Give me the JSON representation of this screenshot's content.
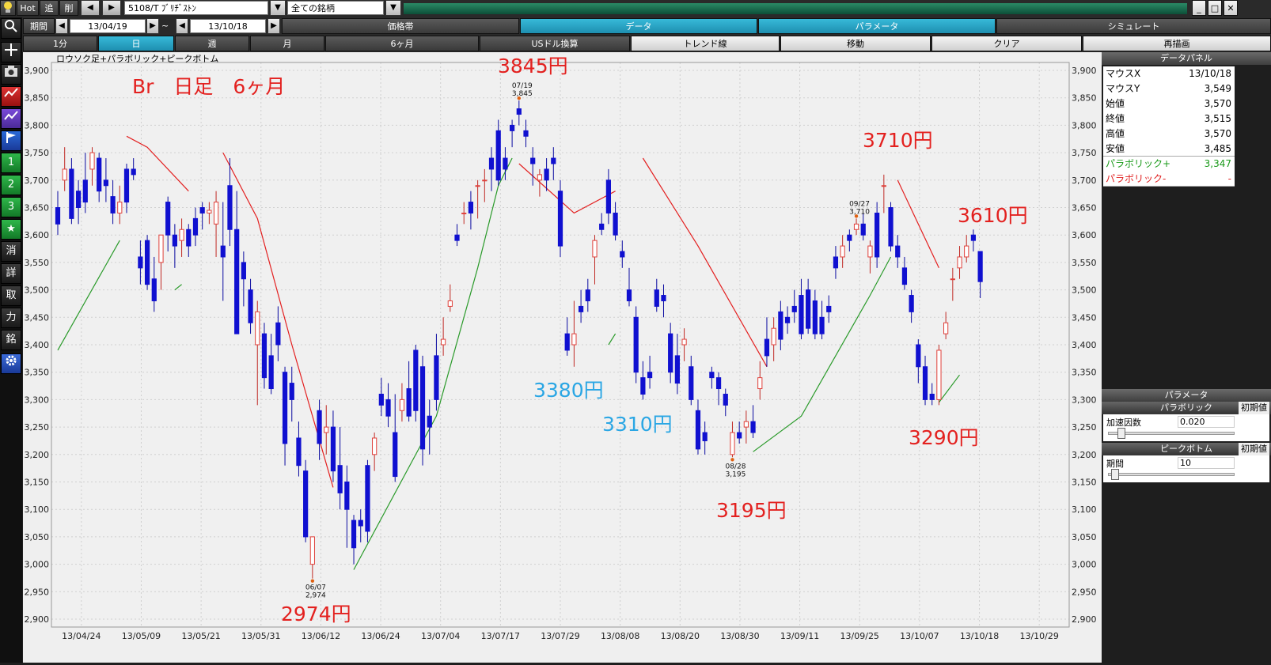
{
  "toolbar": {
    "hot": "Hot",
    "tsui": "追",
    "sakujo": "削",
    "symbol": "5108/T ﾌﾞﾘﾁﾞｽﾄﾝ",
    "list": "全ての銘柄",
    "period_label": "期間",
    "date_from": "13/04/19",
    "tilde": "~",
    "date_to": "13/10/18",
    "tabs": [
      "価格帯",
      "データ",
      "パラメータ",
      "シミュレート"
    ],
    "intervals": [
      "1分",
      "日",
      "週",
      "月",
      "6ヶ月"
    ],
    "tools": [
      "USドル換算",
      "トレンド線",
      "移動",
      "クリア",
      "再描画"
    ]
  },
  "sidebar_labels": [
    "1",
    "2",
    "3",
    "★",
    "消",
    "詳",
    "取",
    "力",
    "銘"
  ],
  "icons": [
    "bulb-icon",
    "prev-arrow-icon",
    "next-arrow-icon",
    "dropdown-icon",
    "search-icon",
    "crosshair-icon",
    "camera-icon",
    "candle-chart-icon",
    "line-chart-icon",
    "flag-icon",
    "star-icon",
    "gear-icon"
  ],
  "chart_title": "ロウソク足+パラボリック+ピークボトム",
  "annotations": {
    "title": "Br　日足　6ヶ月",
    "a3845": "3845円",
    "a2974": "2974円",
    "a3380": "3380円",
    "a3310": "3310円",
    "a3195": "3195円",
    "a3710": "3710円",
    "a3610": "3610円",
    "a3290": "3290円"
  },
  "data_panel": {
    "header": "データパネル",
    "rows": [
      {
        "k": "マウスX",
        "v": "13/10/18"
      },
      {
        "k": "マウスY",
        "v": "3,549"
      },
      {
        "k": "始値",
        "v": "3,570"
      },
      {
        "k": "終値",
        "v": "3,515"
      },
      {
        "k": "高値",
        "v": "3,570"
      },
      {
        "k": "安値",
        "v": "3,485"
      },
      {
        "k": "パラボリック+",
        "v": "3,347"
      },
      {
        "k": "パラボリック-",
        "v": "-"
      }
    ]
  },
  "param_panel": {
    "header": "パラメータ",
    "parabolic": "パラボリック",
    "reset1": "初期値",
    "accel_label": "加速因数",
    "accel": "0.020",
    "peak": "ピークボトム",
    "reset2": "初期値",
    "period_label": "期間",
    "period": "10"
  },
  "colors": {
    "up": "#e0403a",
    "down": "#1010d0",
    "sar_plus": "#2a9a2a",
    "sar_minus": "#e32020",
    "cyan": "#1e9fc4"
  },
  "chart_data": {
    "type": "candlestick",
    "title": "ロウソク足+パラボリック+ピークボトム",
    "ylim": [
      2900,
      3900
    ],
    "yticks": [
      "3,900",
      "3,850",
      "3,800",
      "3,750",
      "3,700",
      "3,650",
      "3,600",
      "3,550",
      "3,500",
      "3,450",
      "3,400",
      "3,350",
      "3,300",
      "3,250",
      "3,200",
      "3,150",
      "3,100",
      "3,050",
      "3,000",
      "2,950",
      "2,900"
    ],
    "xticks": [
      "13/04/24",
      "13/05/09",
      "13/05/21",
      "13/05/31",
      "13/06/12",
      "13/06/24",
      "13/07/04",
      "13/07/17",
      "13/07/29",
      "13/08/08",
      "13/08/20",
      "13/08/30",
      "13/09/11",
      "13/09/25",
      "13/10/07",
      "13/10/18",
      "13/10/29"
    ],
    "peaks": [
      {
        "date": "06/07",
        "value": "2,974"
      },
      {
        "date": "07/19",
        "value": "3,845"
      },
      {
        "date": "08/28",
        "value": "3,195"
      },
      {
        "date": "09/27",
        "value": "3,710"
      }
    ],
    "candles": [
      [
        3650,
        3680,
        3600,
        3620
      ],
      [
        3700,
        3760,
        3680,
        3720
      ],
      [
        3720,
        3740,
        3620,
        3630
      ],
      [
        3680,
        3700,
        3620,
        3650
      ],
      [
        3700,
        3750,
        3640,
        3660
      ],
      [
        3720,
        3760,
        3690,
        3750
      ],
      [
        3740,
        3750,
        3660,
        3680
      ],
      [
        3700,
        3740,
        3660,
        3690
      ],
      [
        3670,
        3700,
        3620,
        3640
      ],
      [
        3640,
        3690,
        3620,
        3660
      ],
      [
        3720,
        3730,
        3640,
        3660
      ],
      [
        3720,
        3740,
        3700,
        3710
      ],
      [
        3560,
        3590,
        3510,
        3540
      ],
      [
        3590,
        3600,
        3500,
        3510
      ],
      [
        3520,
        3560,
        3460,
        3480
      ],
      [
        3550,
        3600,
        3500,
        3600
      ],
      [
        3660,
        3670,
        3570,
        3600
      ],
      [
        3600,
        3620,
        3540,
        3580
      ],
      [
        3590,
        3630,
        3560,
        3610
      ],
      [
        3610,
        3620,
        3560,
        3580
      ],
      [
        3630,
        3650,
        3580,
        3600
      ],
      [
        3650,
        3660,
        3610,
        3640
      ],
      [
        3640,
        3660,
        3620,
        3645
      ],
      [
        3620,
        3680,
        3560,
        3660
      ],
      [
        3580,
        3660,
        3480,
        3560
      ],
      [
        3690,
        3740,
        3580,
        3610
      ],
      [
        3610,
        3680,
        3450,
        3420
      ],
      [
        3550,
        3570,
        3470,
        3520
      ],
      [
        3500,
        3520,
        3420,
        3440
      ],
      [
        3400,
        3480,
        3290,
        3460
      ],
      [
        3420,
        3440,
        3320,
        3340
      ],
      [
        3380,
        3420,
        3310,
        3320
      ],
      [
        3440,
        3470,
        3370,
        3400
      ],
      [
        3350,
        3360,
        3180,
        3220
      ],
      [
        3330,
        3360,
        3260,
        3300
      ],
      [
        3230,
        3260,
        3160,
        3180
      ],
      [
        3170,
        3190,
        3040,
        3050
      ],
      [
        3000,
        3050,
        2974,
        3050
      ],
      [
        3280,
        3300,
        3190,
        3220
      ],
      [
        3240,
        3290,
        3200,
        3250
      ],
      [
        3250,
        3280,
        3150,
        3170
      ],
      [
        3180,
        3250,
        3100,
        3130
      ],
      [
        3150,
        3180,
        3030,
        3100
      ],
      [
        3080,
        3090,
        3000,
        3030
      ],
      [
        3080,
        3100,
        3040,
        3070
      ],
      [
        3180,
        3190,
        3040,
        3060
      ],
      [
        3200,
        3240,
        3170,
        3230
      ],
      [
        3310,
        3340,
        3270,
        3290
      ],
      [
        3300,
        3330,
        3250,
        3270
      ],
      [
        3240,
        3310,
        3150,
        3160
      ],
      [
        3280,
        3330,
        3260,
        3300
      ],
      [
        3320,
        3370,
        3260,
        3270
      ],
      [
        3390,
        3400,
        3260,
        3280
      ],
      [
        3360,
        3380,
        3180,
        3210
      ],
      [
        3270,
        3300,
        3200,
        3250
      ],
      [
        3380,
        3420,
        3280,
        3300
      ],
      [
        3400,
        3450,
        3380,
        3410
      ],
      [
        3470,
        3510,
        3460,
        3480
      ],
      [
        3600,
        3620,
        3580,
        3590
      ],
      [
        3640,
        3660,
        3620,
        3640
      ],
      [
        3660,
        3680,
        3610,
        3640
      ],
      [
        3690,
        3700,
        3630,
        3690
      ],
      [
        3700,
        3720,
        3660,
        3700
      ],
      [
        3740,
        3760,
        3680,
        3720
      ],
      [
        3790,
        3810,
        3690,
        3700
      ],
      [
        3740,
        3760,
        3700,
        3720
      ],
      [
        3800,
        3810,
        3760,
        3790
      ],
      [
        3830,
        3845,
        3800,
        3820
      ],
      [
        3790,
        3810,
        3760,
        3780
      ],
      [
        3740,
        3760,
        3690,
        3730
      ],
      [
        3700,
        3720,
        3670,
        3710
      ],
      [
        3720,
        3740,
        3680,
        3700
      ],
      [
        3740,
        3760,
        3700,
        3730
      ],
      [
        3680,
        3700,
        3560,
        3580
      ],
      [
        3420,
        3450,
        3380,
        3390
      ],
      [
        3400,
        3480,
        3360,
        3420
      ],
      [
        3470,
        3500,
        3440,
        3460
      ],
      [
        3500,
        3520,
        3460,
        3480
      ],
      [
        3560,
        3600,
        3510,
        3590
      ],
      [
        3620,
        3640,
        3600,
        3610
      ],
      [
        3700,
        3720,
        3620,
        3640
      ],
      [
        3640,
        3660,
        3590,
        3600
      ],
      [
        3570,
        3590,
        3540,
        3560
      ],
      [
        3500,
        3540,
        3470,
        3480
      ],
      [
        3450,
        3470,
        3330,
        3350
      ],
      [
        3340,
        3370,
        3300,
        3310
      ],
      [
        3350,
        3380,
        3320,
        3340
      ],
      [
        3500,
        3520,
        3460,
        3470
      ],
      [
        3490,
        3510,
        3450,
        3480
      ],
      [
        3420,
        3440,
        3330,
        3350
      ],
      [
        3380,
        3420,
        3310,
        3330
      ],
      [
        3400,
        3430,
        3370,
        3410
      ],
      [
        3360,
        3380,
        3290,
        3300
      ],
      [
        3280,
        3300,
        3200,
        3210
      ],
      [
        3240,
        3260,
        3200,
        3225
      ],
      [
        3350,
        3360,
        3320,
        3340
      ],
      [
        3340,
        3350,
        3290,
        3320
      ],
      [
        3310,
        3320,
        3270,
        3290
      ],
      [
        3200,
        3260,
        3195,
        3240
      ],
      [
        3240,
        3260,
        3220,
        3230
      ],
      [
        3250,
        3280,
        3220,
        3260
      ],
      [
        3260,
        3290,
        3230,
        3240
      ],
      [
        3320,
        3370,
        3300,
        3340
      ],
      [
        3410,
        3450,
        3360,
        3380
      ],
      [
        3400,
        3450,
        3370,
        3430
      ],
      [
        3460,
        3480,
        3390,
        3410
      ],
      [
        3450,
        3470,
        3420,
        3440
      ],
      [
        3470,
        3500,
        3440,
        3460
      ],
      [
        3490,
        3520,
        3410,
        3420
      ],
      [
        3500,
        3520,
        3420,
        3430
      ],
      [
        3480,
        3500,
        3410,
        3420
      ],
      [
        3450,
        3480,
        3410,
        3420
      ],
      [
        3470,
        3490,
        3440,
        3460
      ],
      [
        3560,
        3580,
        3520,
        3540
      ],
      [
        3560,
        3600,
        3540,
        3580
      ],
      [
        3600,
        3610,
        3570,
        3590
      ],
      [
        3610,
        3630,
        3600,
        3620
      ],
      [
        3620,
        3640,
        3590,
        3600
      ],
      [
        3560,
        3590,
        3530,
        3580
      ],
      [
        3640,
        3660,
        3540,
        3560
      ],
      [
        3690,
        3710,
        3640,
        3690
      ],
      [
        3650,
        3660,
        3570,
        3580
      ],
      [
        3580,
        3600,
        3540,
        3560
      ],
      [
        3540,
        3560,
        3500,
        3510
      ],
      [
        3490,
        3500,
        3440,
        3460
      ],
      [
        3400,
        3410,
        3330,
        3360
      ],
      [
        3360,
        3380,
        3290,
        3300
      ],
      [
        3310,
        3330,
        3290,
        3300
      ],
      [
        3300,
        3400,
        3290,
        3390
      ],
      [
        3420,
        3460,
        3410,
        3440
      ],
      [
        3520,
        3540,
        3480,
        3520
      ],
      [
        3540,
        3580,
        3520,
        3560
      ],
      [
        3560,
        3600,
        3550,
        3580
      ],
      [
        3600,
        3610,
        3570,
        3590
      ],
      [
        3570,
        3570,
        3485,
        3515
      ]
    ],
    "sar_plus_segments": [
      [
        [
          0,
          3390
        ],
        [
          9,
          3590
        ]
      ],
      [
        [
          17,
          3500
        ],
        [
          18,
          3510
        ]
      ],
      [
        [
          43,
          2990
        ],
        [
          55,
          3270
        ],
        [
          61,
          3540
        ],
        [
          64,
          3690
        ],
        [
          66,
          3740
        ]
      ],
      [
        [
          80,
          3400
        ],
        [
          81,
          3420
        ]
      ],
      [
        [
          101,
          3205
        ],
        [
          108,
          3270
        ],
        [
          113,
          3380
        ],
        [
          118,
          3490
        ],
        [
          121,
          3560
        ]
      ],
      [
        [
          128,
          3295
        ],
        [
          131,
          3345
        ]
      ]
    ],
    "sar_minus_segments": [
      [
        [
          10,
          3780
        ],
        [
          13,
          3760
        ],
        [
          19,
          3680
        ]
      ],
      [
        [
          24,
          3750
        ],
        [
          29,
          3630
        ],
        [
          34,
          3400
        ],
        [
          40,
          3140
        ]
      ],
      [
        [
          67,
          3730
        ],
        [
          75,
          3640
        ],
        [
          81,
          3680
        ]
      ],
      [
        [
          85,
          3740
        ],
        [
          93,
          3580
        ],
        [
          103,
          3360
        ]
      ],
      [
        [
          122,
          3700
        ],
        [
          128,
          3540
        ]
      ]
    ]
  }
}
